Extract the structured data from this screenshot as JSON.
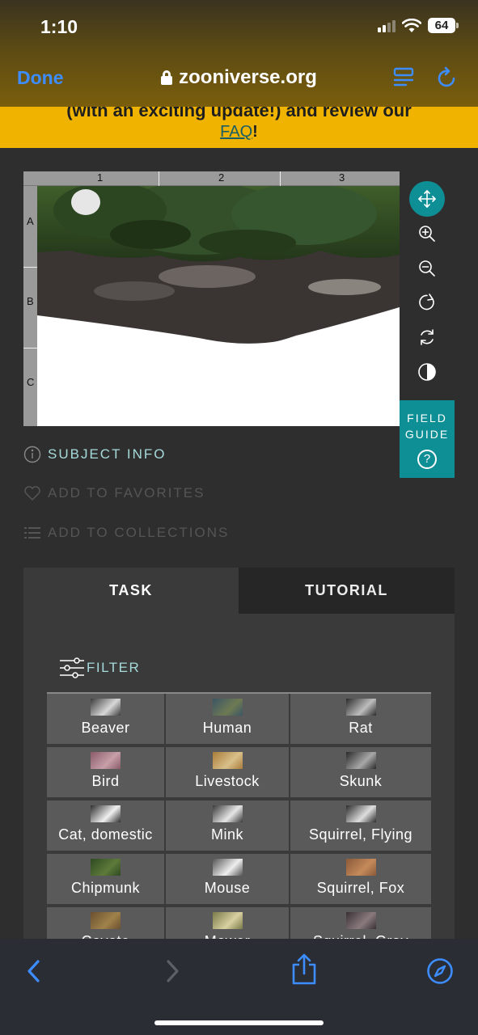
{
  "status_bar": {
    "time": "1:10",
    "battery": "64"
  },
  "browser": {
    "done_label": "Done",
    "url": "zooniverse.org"
  },
  "banner": {
    "line1": "(with an exciting update!) and review our",
    "link_text": "FAQ",
    "suffix": "!"
  },
  "subject": {
    "columns": [
      "1",
      "2",
      "3"
    ],
    "rows": [
      "A",
      "B",
      "C"
    ]
  },
  "toolbar": {
    "tools": [
      "move-icon",
      "zoom-in-icon",
      "zoom-out-icon",
      "rotate-icon",
      "reset-icon",
      "invert-icon"
    ],
    "field_guide_line1": "FIELD",
    "field_guide_line2": "GUIDE",
    "field_guide_help": "?"
  },
  "meta": {
    "subject_info": "SUBJECT INFO",
    "add_favorites": "ADD TO FAVORITES",
    "add_collections": "ADD TO COLLECTIONS"
  },
  "panel": {
    "tabs": {
      "task": "TASK",
      "tutorial": "TUTORIAL"
    },
    "filter_label": "FILTER",
    "species": [
      {
        "label": "Beaver",
        "thumb": [
          "#3d3d3d",
          "#d8d8d8"
        ]
      },
      {
        "label": "Human",
        "thumb": [
          "#3b5566",
          "#6f7a52"
        ]
      },
      {
        "label": "Rat",
        "thumb": [
          "#2c2c2c",
          "#bdbdbd"
        ]
      },
      {
        "label": "Bird",
        "thumb": [
          "#8a5a6a",
          "#c7a0a8"
        ]
      },
      {
        "label": "Livestock",
        "thumb": [
          "#a97c3a",
          "#d9c08a"
        ]
      },
      {
        "label": "Skunk",
        "thumb": [
          "#2a2a2a",
          "#a8a8a8"
        ]
      },
      {
        "label": "Cat, domestic",
        "thumb": [
          "#2f2f2f",
          "#f0f0f0"
        ]
      },
      {
        "label": "Mink",
        "thumb": [
          "#3a3a3a",
          "#e6e6e6"
        ]
      },
      {
        "label": "Squirrel, Flying",
        "thumb": [
          "#2d2d2d",
          "#dedede"
        ]
      },
      {
        "label": "Chipmunk",
        "thumb": [
          "#2e4a22",
          "#5e7a3a"
        ]
      },
      {
        "label": "Mouse",
        "thumb": [
          "#555555",
          "#eeeeee"
        ]
      },
      {
        "label": "Squirrel, Fox",
        "thumb": [
          "#8a5a3a",
          "#c58a5a"
        ]
      },
      {
        "label": "Coyote",
        "thumb": [
          "#6a5030",
          "#a0824a"
        ]
      },
      {
        "label": "Mower",
        "thumb": [
          "#7a7a4a",
          "#d8d0a0"
        ]
      },
      {
        "label": "Squirrel, Gray",
        "thumb": [
          "#3a3236",
          "#8a7a7e"
        ]
      }
    ]
  },
  "colors": {
    "accent": "#0e8f96",
    "banner": "#f0b400",
    "link_blue": "#3d8dff"
  }
}
